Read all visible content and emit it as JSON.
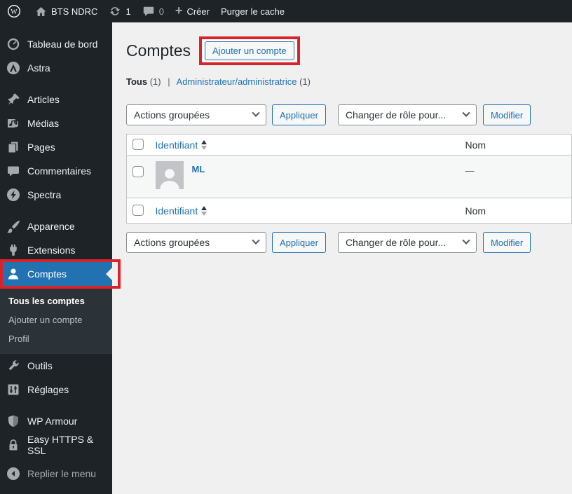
{
  "admin_bar": {
    "site_name": "BTS NDRC",
    "updates_count": "1",
    "comments_count": "0",
    "create_label": "Créer",
    "purge_label": "Purger le cache"
  },
  "sidebar": {
    "items": [
      {
        "label": "Tableau de bord",
        "icon": "dashboard-icon"
      },
      {
        "label": "Astra",
        "icon": "astra-logo-icon"
      },
      {
        "label": "Articles",
        "icon": "pushpin-icon"
      },
      {
        "label": "Médias",
        "icon": "media-icon"
      },
      {
        "label": "Pages",
        "icon": "pages-icon"
      },
      {
        "label": "Commentaires",
        "icon": "comments-icon"
      },
      {
        "label": "Spectra",
        "icon": "spectra-logo-icon"
      },
      {
        "label": "Apparence",
        "icon": "brush-icon"
      },
      {
        "label": "Extensions",
        "icon": "plugin-icon"
      },
      {
        "label": "Comptes",
        "icon": "users-icon",
        "active": true
      },
      {
        "label": "Outils",
        "icon": "wrench-icon"
      },
      {
        "label": "Réglages",
        "icon": "settings-icon"
      },
      {
        "label": "WP Armour",
        "icon": "shield-icon"
      },
      {
        "label": "Easy HTTPS & SSL",
        "icon": "lock-icon"
      },
      {
        "label": "Replier le menu",
        "icon": "collapse-icon"
      }
    ],
    "submenu": [
      "Tous les comptes",
      "Ajouter un compte",
      "Profil"
    ]
  },
  "main": {
    "title": "Comptes",
    "add_button": "Ajouter un compte",
    "views": {
      "all": "Tous",
      "all_count": "(1)",
      "separator": "|",
      "admin": "Administrateur/administratrice",
      "admin_count": "(1)"
    },
    "bulk": {
      "actions": "Actions groupées",
      "apply": "Appliquer",
      "role": "Changer de rôle pour...",
      "change": "Modifier"
    },
    "table": {
      "username_header": "Identifiant",
      "name_header": "Nom",
      "rows": [
        {
          "username": "ML",
          "name": "—"
        }
      ]
    }
  },
  "colors": {
    "accent_blue": "#2271b1",
    "annotation_red": "#d9232b",
    "sidebar_bg": "#1d2327",
    "submenu_bg": "#2c3338",
    "content_bg": "#f0f0f1",
    "row_stripe": "#f6f7f7",
    "border_gray": "#c3c4c7",
    "input_border": "#8c8f94",
    "text_muted": "#50575e",
    "icon_gray": "#a7aaad"
  }
}
